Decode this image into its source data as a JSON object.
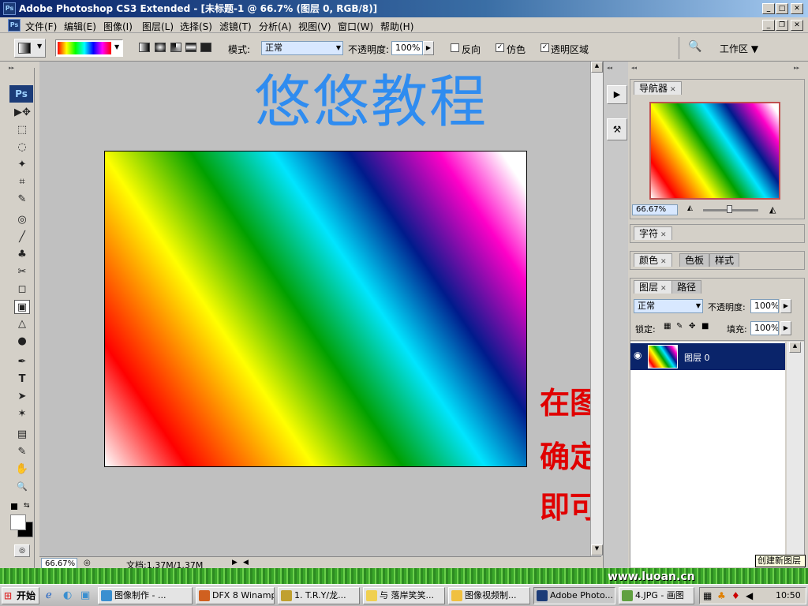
{
  "window": {
    "title": "Adobe Photoshop CS3 Extended - [未标题-1 @ 66.7% (图层 0, RGB/8)]",
    "ps_icon_text": "Ps"
  },
  "menu": [
    "文件(F)",
    "编辑(E)",
    "图像(I)",
    "图层(L)",
    "选择(S)",
    "滤镜(T)",
    "分析(A)",
    "视图(V)",
    "窗口(W)",
    "帮助(H)"
  ],
  "options": {
    "mode_label": "模式:",
    "mode_value": "正常",
    "opacity_label": "不透明度:",
    "opacity_value": "100%",
    "reverse_label": "反向",
    "dither_label": "仿色",
    "transparency_label": "透明区域",
    "workspace_label": "工作区 ▼"
  },
  "toolbox": {
    "logo": "Ps",
    "tools": [
      "▶✥",
      "⬚",
      "◌",
      "✦",
      "⌗",
      "✎",
      "◎",
      "╱",
      "♣",
      "✂",
      "◻",
      "▣",
      "△",
      "●",
      "✒",
      "T",
      "➤",
      "✶",
      "▤",
      "✎",
      "✋",
      "🔍"
    ]
  },
  "canvas": {
    "watermark": "悠悠教程",
    "notes": [
      "在图层拉一直线",
      "确定",
      "即可看到渐变效果"
    ]
  },
  "status": {
    "zoom": "66.67%",
    "doc_info": "文档:1.37M/1.37M"
  },
  "navigator": {
    "tab": "导航器",
    "zoom": "66.67%"
  },
  "character": {
    "tab": "字符"
  },
  "color_group": {
    "tabs": [
      "颜色",
      "色板",
      "样式"
    ]
  },
  "layers": {
    "tabs": [
      "图层",
      "路径"
    ],
    "blend_mode": "正常",
    "opacity_label": "不透明度:",
    "opacity_value": "100%",
    "lock_label": "锁定:",
    "fill_label": "填充:",
    "fill_value": "100%",
    "layer_name": "图层 0",
    "new_layer_tooltip": "创建新图层"
  },
  "taskbar": {
    "start": "开始",
    "items": [
      "图像制作 - ...",
      "DFX 8 Winamp",
      "1. T.R.Y/龙...",
      "与 落岸笑笑...",
      "图像视频制...",
      "Adobe Photo...",
      "4.JPG - 画图"
    ],
    "clock": "10:50",
    "site_text": "www.luoan.cn"
  },
  "colors": {
    "watermark": "#2f8cf0",
    "notes": "#e00000",
    "title_bar": "#0a246a",
    "layer_selected": "#0a246a"
  }
}
